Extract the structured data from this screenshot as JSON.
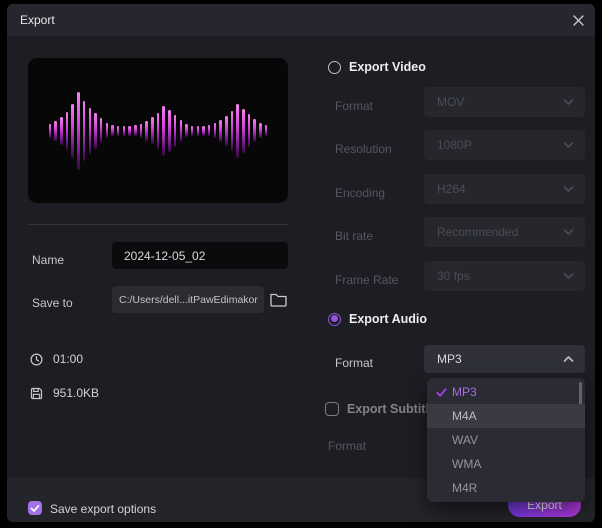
{
  "title_bar": {
    "title": "Export"
  },
  "colors": {
    "accent": "#9254de",
    "button_gradient_start": "#7a3bec",
    "button_gradient_end": "#b93ae4",
    "waveform_top": "#f584ee",
    "waveform_bottom": "#35093e",
    "dialog_bg": "#1d1e24"
  },
  "preview": {
    "waveform_bars": [
      14,
      20,
      28,
      38,
      54,
      78,
      60,
      46,
      36,
      25,
      15,
      11,
      10,
      10,
      10,
      11,
      14,
      20,
      27,
      36,
      50,
      42,
      32,
      22,
      13,
      10,
      10,
      10,
      11,
      15,
      22,
      30,
      40,
      54,
      44,
      33,
      23,
      15,
      11
    ]
  },
  "left": {
    "name_label": "Name",
    "name_value": "2024-12-05_02",
    "save_to_label": "Save to",
    "save_to_value": "C:/Users/dell...itPawEdimakor",
    "duration": "01:00",
    "size": "951.0KB"
  },
  "video": {
    "radio_label": "Export Video",
    "selected": false,
    "rows": [
      {
        "label": "Format",
        "value": "MOV"
      },
      {
        "label": "Resolution",
        "value": "1080P"
      },
      {
        "label": "Encoding",
        "value": "H264"
      },
      {
        "label": "Bit rate",
        "value": "Recommended"
      },
      {
        "label": "Frame Rate",
        "value": "30  fps"
      }
    ]
  },
  "audio": {
    "radio_label": "Export Audio",
    "selected": true,
    "format_label": "Format",
    "format_value": "MP3",
    "dropdown_options": [
      {
        "label": "MP3",
        "checked": true,
        "highlighted": false
      },
      {
        "label": "M4A",
        "checked": false,
        "highlighted": true
      },
      {
        "label": "WAV",
        "checked": false,
        "highlighted": false
      },
      {
        "label": "WMA",
        "checked": false,
        "highlighted": false
      },
      {
        "label": "M4R",
        "checked": false,
        "highlighted": false
      }
    ]
  },
  "subtitles": {
    "checkbox_label": "Export Subtitles",
    "checked": false,
    "format_label": "Format"
  },
  "footer": {
    "save_options_label": "Save export options",
    "save_options_checked": true,
    "export_button_label": "Export"
  }
}
